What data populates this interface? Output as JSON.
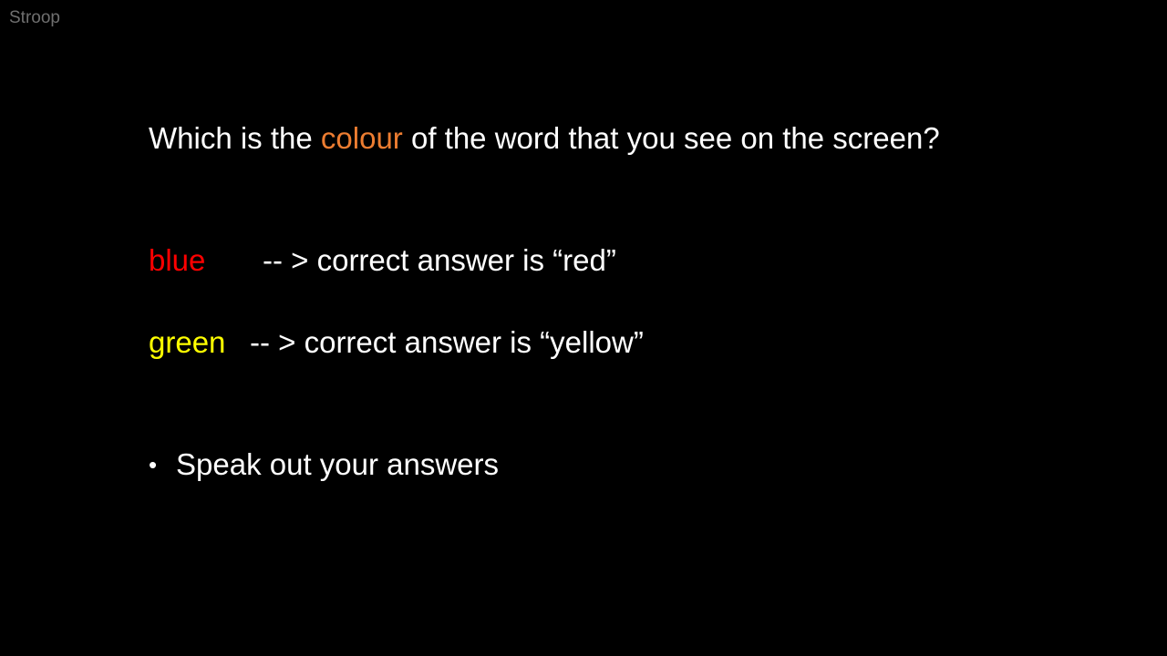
{
  "slide": {
    "label": "Stroop",
    "background": "#000000"
  },
  "question": {
    "prefix": "Which is the ",
    "highlight": "colour",
    "suffix": " of the word that you see on the screen?",
    "highlight_color": "#ed7d31",
    "text_color": "#ffffff"
  },
  "examples": [
    {
      "word": "blue",
      "word_color": "#ff0000",
      "answer": "-- > correct answer is “red”"
    },
    {
      "word": "green",
      "word_color": "#ffff00",
      "answer": "-- > correct answer is “yellow”"
    }
  ],
  "bullets": [
    {
      "marker": "•",
      "text": "Speak out your answers"
    }
  ]
}
